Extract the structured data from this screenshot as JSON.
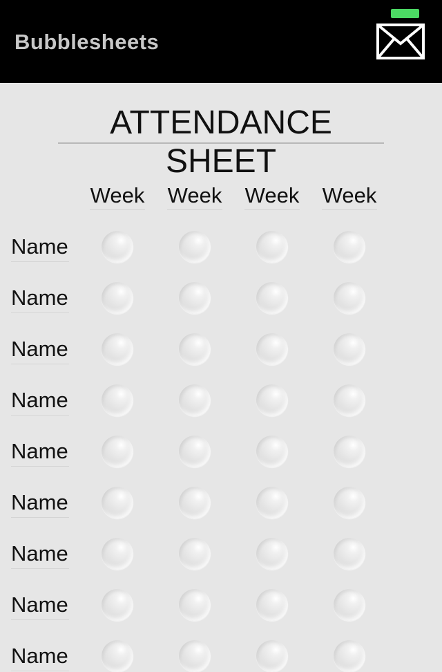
{
  "app": {
    "title": "Bubblesheets"
  },
  "toolbar": {
    "mail_icon": "envelope-icon",
    "status_color": "#4cd964"
  },
  "sheet": {
    "title": "ATTENDANCE SHEET",
    "weeks": [
      "Week",
      "Week",
      "Week",
      "Week"
    ],
    "names": [
      "Name",
      "Name",
      "Name",
      "Name",
      "Name",
      "Name",
      "Name",
      "Name",
      "Name"
    ]
  }
}
